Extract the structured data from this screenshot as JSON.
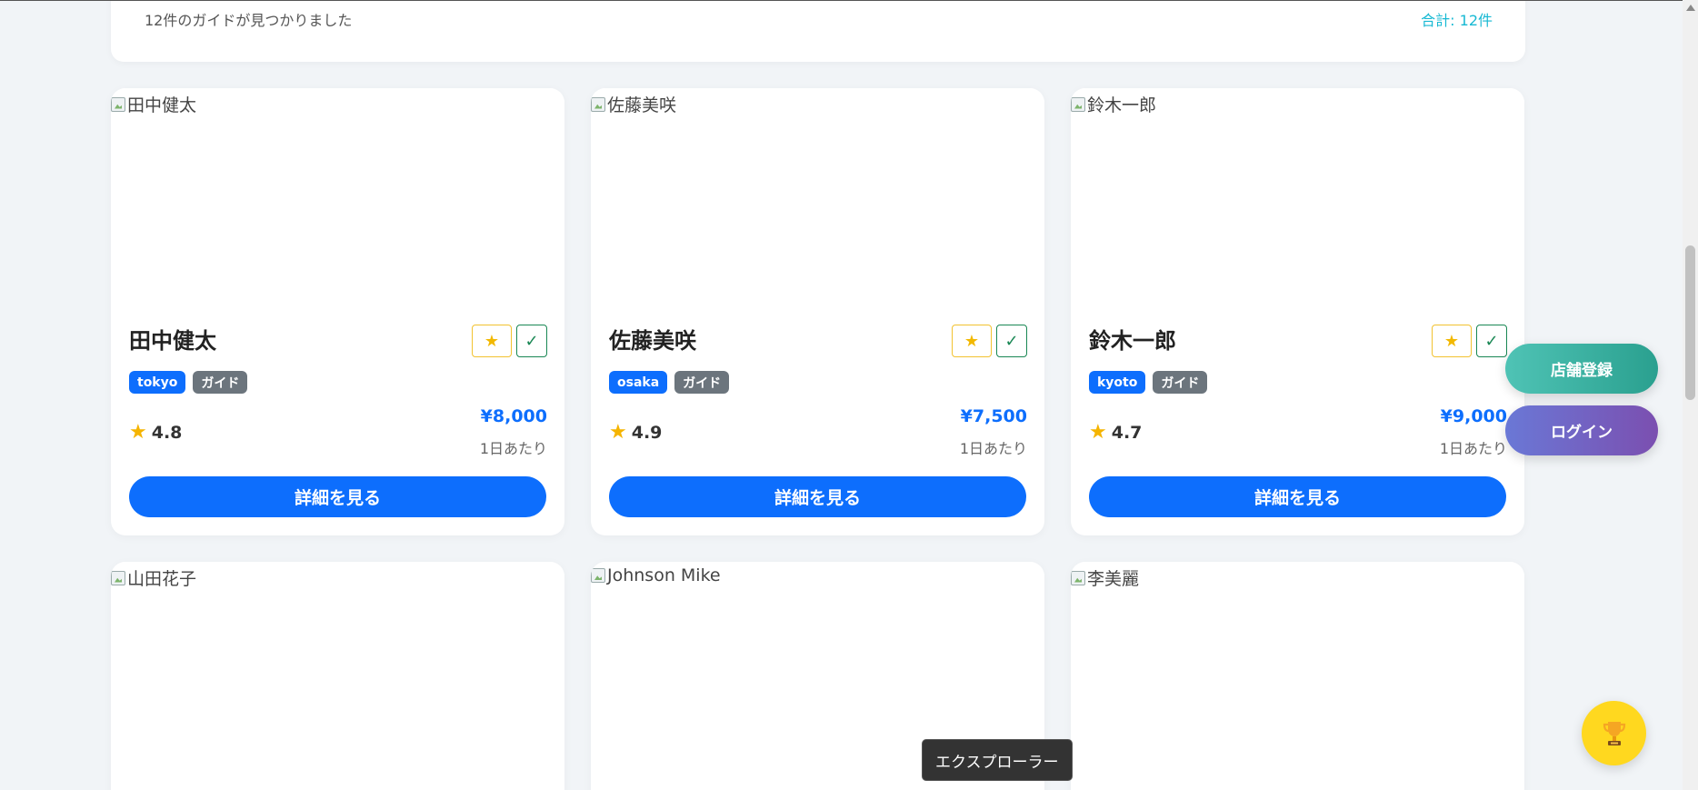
{
  "summary": {
    "count_text": "12件のガイドが見つかりました",
    "total_text": "合計: 12件"
  },
  "guides": [
    {
      "image_alt": "田中健太",
      "name": "田中健太",
      "city": "tokyo",
      "type": "ガイド",
      "rating": "4.8",
      "price": "¥8,000",
      "per_day": "1日あたり",
      "detail": "詳細を見る"
    },
    {
      "image_alt": "佐藤美咲",
      "name": "佐藤美咲",
      "city": "osaka",
      "type": "ガイド",
      "rating": "4.9",
      "price": "¥7,500",
      "per_day": "1日あたり",
      "detail": "詳細を見る"
    },
    {
      "image_alt": "鈴木一郎",
      "name": "鈴木一郎",
      "city": "kyoto",
      "type": "ガイド",
      "rating": "4.7",
      "price": "¥9,000",
      "per_day": "1日あたり",
      "detail": "詳細を見る"
    },
    {
      "image_alt": "山田花子"
    },
    {
      "image_alt": "Johnson Mike"
    },
    {
      "image_alt": "李美麗"
    }
  ],
  "icons": {
    "favorite": "star-icon",
    "check": "check-icon",
    "rating": "star-icon",
    "trophy": "trophy-icon"
  },
  "glyphs": {
    "star": "★",
    "check": "✓"
  },
  "floating": {
    "store_register": "店舗登録",
    "login": "ログイン"
  },
  "tooltip": "エクスプローラー",
  "colors": {
    "primary": "#0d6efd",
    "total_accent": "#17b9d3",
    "favorite": "#f2c230",
    "check": "#198754",
    "trophy_bg": "#ffd81f"
  }
}
